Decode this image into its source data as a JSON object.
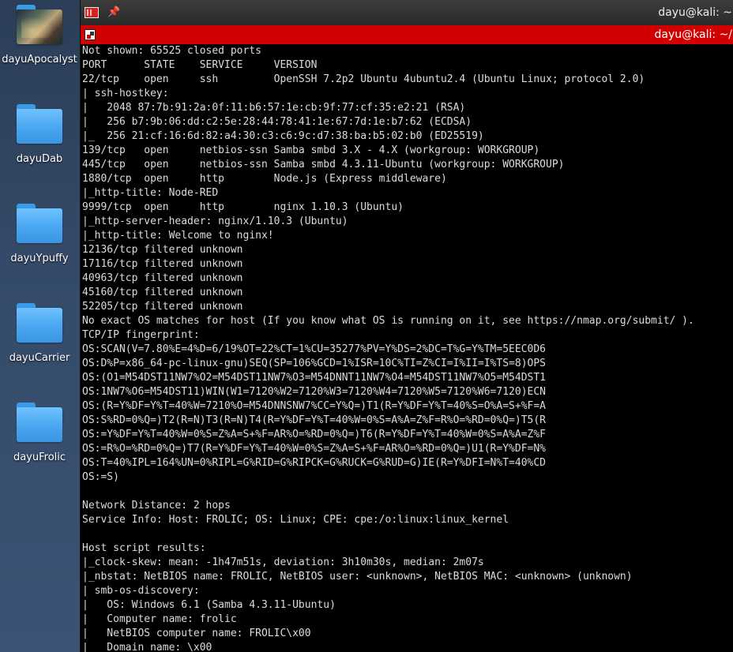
{
  "desktop": {
    "icons": [
      {
        "label": "dayuApocalyst",
        "type": "image-folder"
      },
      {
        "label": "dayuDab",
        "type": "folder"
      },
      {
        "label": "dayuYpuffy",
        "type": "folder"
      },
      {
        "label": "dayuCarrier",
        "type": "folder"
      },
      {
        "label": "dayuFrolic",
        "type": "folder"
      }
    ]
  },
  "window": {
    "title": "dayu@kali: ~",
    "tab_title": "dayu@kali: ~/",
    "accent_color": "#d20000",
    "app_icon": "terminal-icon",
    "pin_icon": "pin-icon"
  },
  "terminal": {
    "lines": [
      "Not shown: 65525 closed ports",
      "PORT      STATE    SERVICE     VERSION",
      "22/tcp    open     ssh         OpenSSH 7.2p2 Ubuntu 4ubuntu2.4 (Ubuntu Linux; protocol 2.0)",
      "| ssh-hostkey:",
      "|   2048 87:7b:91:2a:0f:11:b6:57:1e:cb:9f:77:cf:35:e2:21 (RSA)",
      "|   256 b7:9b:06:dd:c2:5e:28:44:78:41:1e:67:7d:1e:b7:62 (ECDSA)",
      "|_  256 21:cf:16:6d:82:a4:30:c3:c6:9c:d7:38:ba:b5:02:b0 (ED25519)",
      "139/tcp   open     netbios-ssn Samba smbd 3.X - 4.X (workgroup: WORKGROUP)",
      "445/tcp   open     netbios-ssn Samba smbd 4.3.11-Ubuntu (workgroup: WORKGROUP)",
      "1880/tcp  open     http        Node.js (Express middleware)",
      "|_http-title: Node-RED",
      "9999/tcp  open     http        nginx 1.10.3 (Ubuntu)",
      "|_http-server-header: nginx/1.10.3 (Ubuntu)",
      "|_http-title: Welcome to nginx!",
      "12136/tcp filtered unknown",
      "17116/tcp filtered unknown",
      "40963/tcp filtered unknown",
      "45160/tcp filtered unknown",
      "52205/tcp filtered unknown",
      "No exact OS matches for host (If you know what OS is running on it, see https://nmap.org/submit/ ).",
      "TCP/IP fingerprint:",
      "OS:SCAN(V=7.80%E=4%D=6/19%OT=22%CT=1%CU=35277%PV=Y%DS=2%DC=T%G=Y%TM=5EEC0D6",
      "OS:D%P=x86_64-pc-linux-gnu)SEQ(SP=106%GCD=1%ISR=10C%TI=Z%CI=I%II=I%TS=8)OPS",
      "OS:(O1=M54DST11NW7%O2=M54DST11NW7%O3=M54DNNT11NW7%O4=M54DST11NW7%O5=M54DST1",
      "OS:1NW7%O6=M54DST11)WIN(W1=7120%W2=7120%W3=7120%W4=7120%W5=7120%W6=7120)ECN",
      "OS:(R=Y%DF=Y%T=40%W=7210%O=M54DNNSNW7%CC=Y%Q=)T1(R=Y%DF=Y%T=40%S=O%A=S+%F=A",
      "OS:S%RD=0%Q=)T2(R=N)T3(R=N)T4(R=Y%DF=Y%T=40%W=0%S=A%A=Z%F=R%O=%RD=0%Q=)T5(R",
      "OS:=Y%DF=Y%T=40%W=0%S=Z%A=S+%F=AR%O=%RD=0%Q=)T6(R=Y%DF=Y%T=40%W=0%S=A%A=Z%F",
      "OS:=R%O=%RD=0%Q=)T7(R=Y%DF=Y%T=40%W=0%S=Z%A=S+%F=AR%O=%RD=0%Q=)U1(R=Y%DF=N%",
      "OS:T=40%IPL=164%UN=0%RIPL=G%RID=G%RIPCK=G%RUCK=G%RUD=G)IE(R=Y%DFI=N%T=40%CD",
      "OS:=S)",
      "",
      "Network Distance: 2 hops",
      "Service Info: Host: FROLIC; OS: Linux; CPE: cpe:/o:linux:linux_kernel",
      "",
      "Host script results:",
      "|_clock-skew: mean: -1h47m51s, deviation: 3h10m30s, median: 2m07s",
      "|_nbstat: NetBIOS name: FROLIC, NetBIOS user: <unknown>, NetBIOS MAC: <unknown> (unknown)",
      "| smb-os-discovery:",
      "|   OS: Windows 6.1 (Samba 4.3.11-Ubuntu)",
      "|   Computer name: frolic",
      "|   NetBIOS computer name: FROLIC\\x00",
      "|   Domain name: \\x00"
    ]
  }
}
